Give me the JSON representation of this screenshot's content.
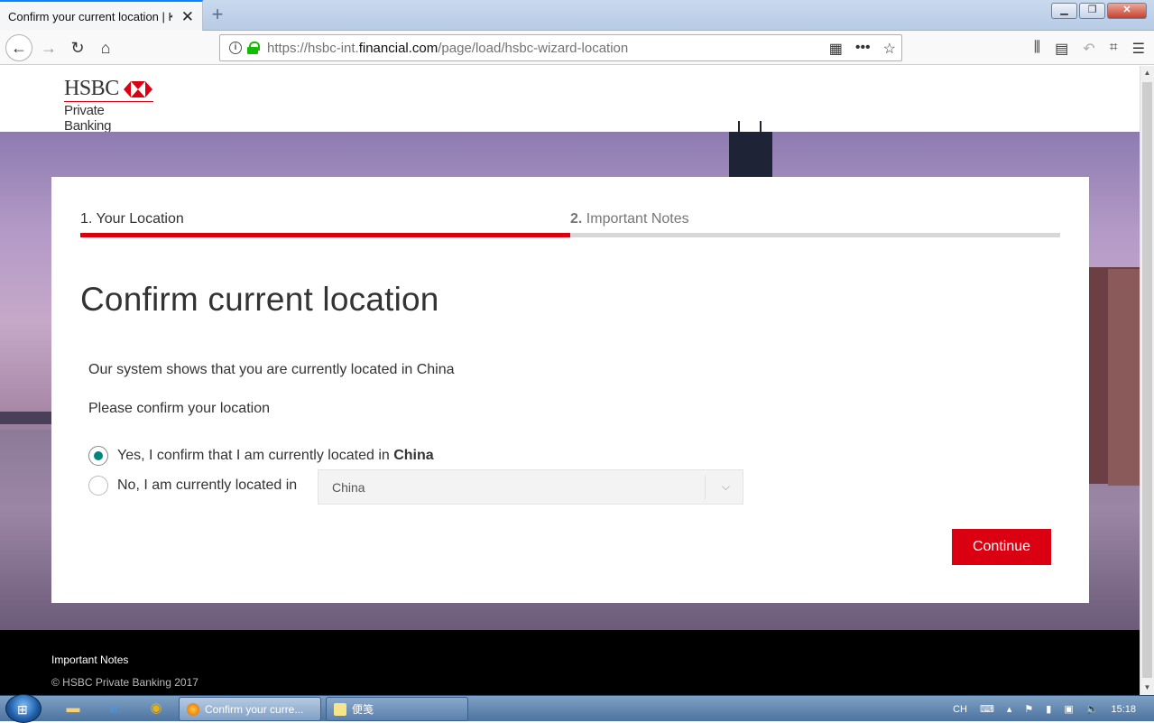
{
  "browser": {
    "tab_title": "Confirm your current location | K",
    "new_tab": "+",
    "url_prefix": "https://hsbc-int.",
    "url_domain": "financial.com",
    "url_path": "/page/load/hsbc-wizard-location"
  },
  "header": {
    "brand": "HSBC",
    "brand_sub": "Private Banking"
  },
  "steps": [
    {
      "num": "1.",
      "label": "Your Location"
    },
    {
      "num": "2.",
      "label": "Important Notes"
    }
  ],
  "main": {
    "title": "Confirm current location",
    "system_text": "Our system shows that you are currently located in China",
    "prompt": "Please confirm your location",
    "option_yes_prefix": "Yes, I confirm that I am currently located in",
    "option_yes_country": "China",
    "option_no": "No, I am currently located in",
    "selected_country": "China",
    "continue": "Continue"
  },
  "footer": {
    "link": "Important Notes",
    "copyright": "© HSBC Private Banking 2017"
  },
  "taskbar": {
    "task_browser": "Confirm your curre...",
    "task_note": "便笺",
    "lang": "CH",
    "time": "15:18"
  },
  "colors": {
    "brand_red": "#db0011",
    "radio_green": "#00847f"
  }
}
